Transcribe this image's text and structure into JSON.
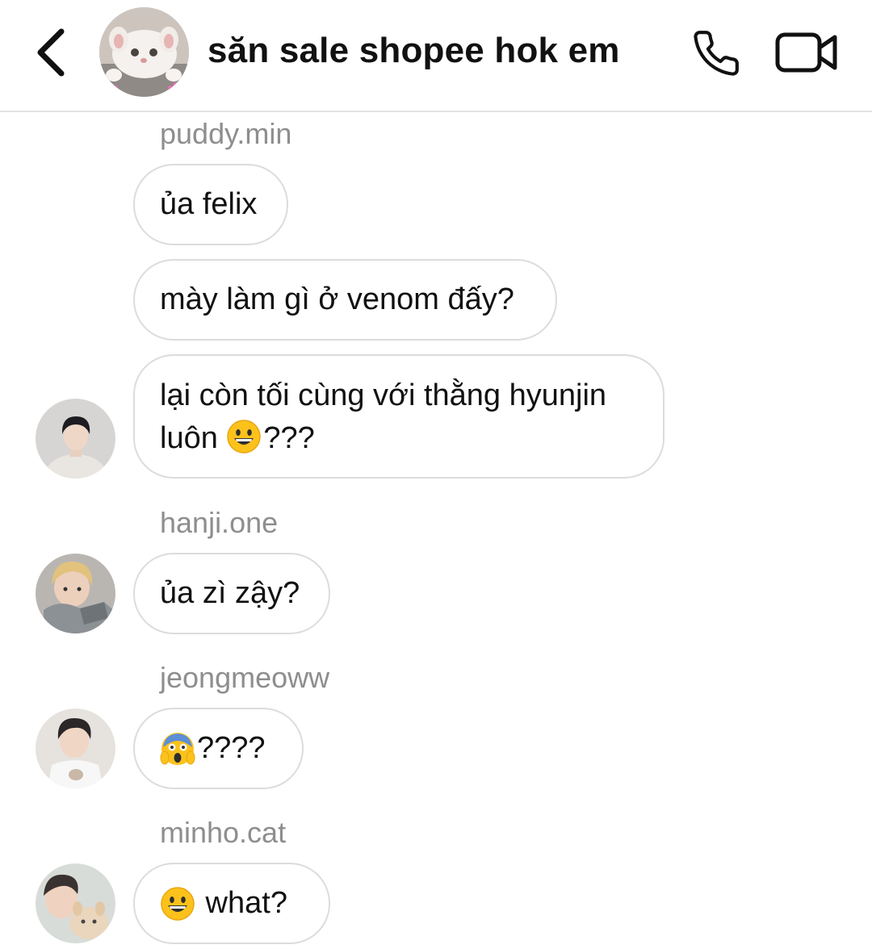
{
  "header": {
    "title": "săn sale shopee hok em",
    "back_icon": "chevron-left-icon",
    "call_icon": "phone-icon",
    "video_icon": "video-camera-icon"
  },
  "messages": [
    {
      "sender": "puddy.min",
      "text": "ủa felix"
    },
    {
      "text": "mày làm gì ở venom đấy?"
    },
    {
      "text_line1": "lại còn tối cùng với thằng hyunjin",
      "text_line2_prefix": "luôn",
      "emoji": "grinning-face-emoji",
      "text_line2_suffix": "???"
    },
    {
      "sender": "hanji.one",
      "text": "ủa zì zậy?"
    },
    {
      "sender": "jeongmeoww",
      "emoji": "screaming-face-emoji",
      "text": "????"
    },
    {
      "sender": "minho.cat",
      "emoji": "grinning-face-emoji",
      "text": " what?"
    }
  ],
  "colors": {
    "bubble_border": "#dcdcdc",
    "sender_name": "#8e8e8e",
    "divider": "#e3e3e3"
  }
}
